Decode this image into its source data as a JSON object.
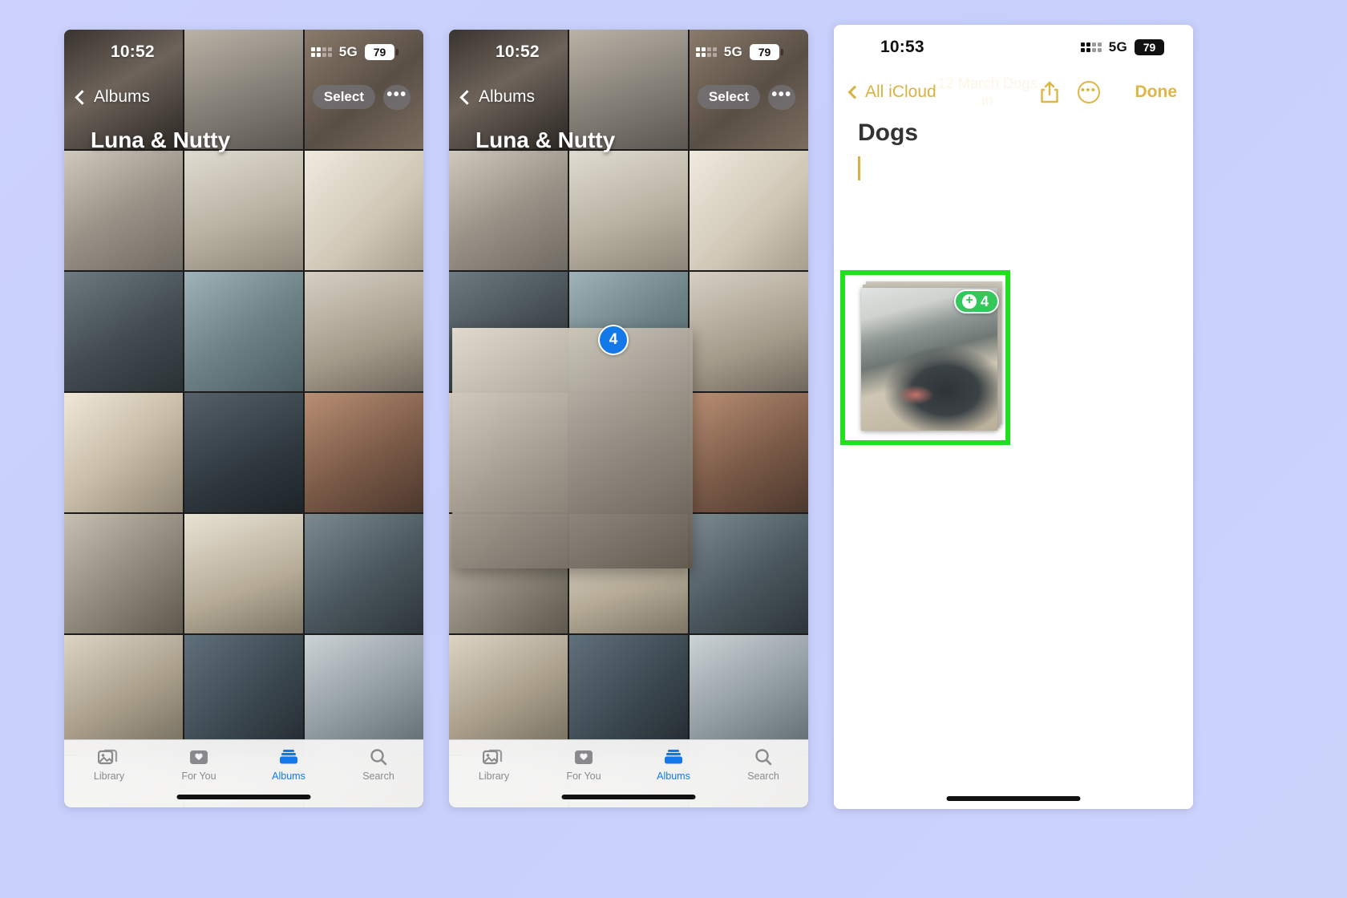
{
  "page": {
    "background_color": "#c9d0fb",
    "accent_blue": "#1479e8",
    "accent_gold": "#dfb544",
    "highlight_green": "#20e020",
    "badge_green": "#34c759"
  },
  "phone1": {
    "status": {
      "time": "10:52",
      "network": "5G",
      "battery": "79",
      "signal_icon": "cellular-signal-icon"
    },
    "nav": {
      "back_label": "Albums",
      "back_icon": "chevron-left-icon",
      "select_label": "Select",
      "more_label": "•••",
      "more_icon": "ellipsis-icon"
    },
    "album_title": "Luna & Nutty",
    "tabs": [
      {
        "label": "Library",
        "icon": "library-icon",
        "active": false
      },
      {
        "label": "For You",
        "icon": "for-you-icon",
        "active": false
      },
      {
        "label": "Albums",
        "icon": "albums-icon",
        "active": true
      },
      {
        "label": "Search",
        "icon": "search-icon",
        "active": false
      }
    ]
  },
  "phone2": {
    "status": {
      "time": "10:52",
      "network": "5G",
      "battery": "79",
      "signal_icon": "cellular-signal-icon"
    },
    "nav": {
      "back_label": "Albums",
      "back_icon": "chevron-left-icon",
      "select_label": "Select",
      "more_label": "•••",
      "more_icon": "ellipsis-icon"
    },
    "album_title": "Luna & Nutty",
    "drag_badge_count": "4",
    "tabs": [
      {
        "label": "Library",
        "icon": "library-icon",
        "active": false
      },
      {
        "label": "For You",
        "icon": "for-you-icon",
        "active": false
      },
      {
        "label": "Albums",
        "icon": "albums-icon",
        "active": true
      },
      {
        "label": "Search",
        "icon": "search-icon",
        "active": false
      }
    ]
  },
  "phone3": {
    "status": {
      "time": "10:53",
      "network": "5G",
      "battery": "79",
      "signal_icon": "cellular-signal-icon"
    },
    "nav": {
      "back_label": "All iCloud",
      "back_icon": "chevron-left-icon",
      "ghost_label": "12 March Dogs in",
      "share_icon": "share-icon",
      "more_icon": "more-circle-icon",
      "more_label": "•••",
      "done_label": "Done"
    },
    "note_title": "Dogs",
    "drop_badge": {
      "plus": "+",
      "count": "4"
    }
  }
}
